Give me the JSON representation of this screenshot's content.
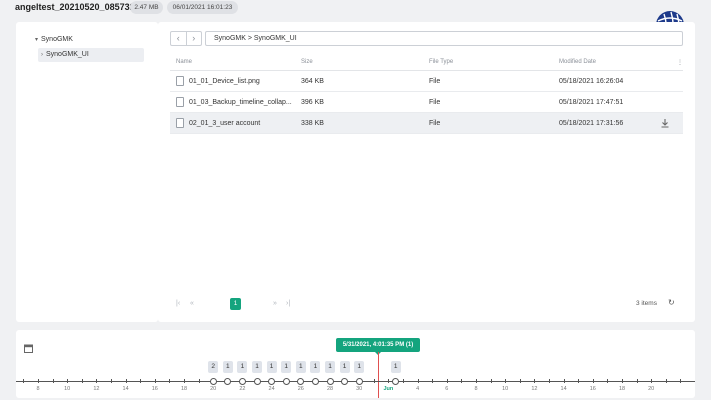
{
  "header": {
    "title": "angeltest_20210520_085732",
    "size": "2.47 MB",
    "datetime": "06/01/2021 16:01:23",
    "logo_icon": "synology-globe-icon"
  },
  "tree": {
    "root": "SynoGMK",
    "child": "SynoGMK_UI"
  },
  "path": {
    "back_icon": "chevron-left-icon",
    "forward_icon": "chevron-right-icon",
    "breadcrumb": "SynoGMK  >  SynoGMK_UI"
  },
  "table": {
    "columns": [
      "Name",
      "Size",
      "File Type",
      "Modified Date"
    ],
    "rows": [
      {
        "name": "01_01_Device_list.png",
        "size": "364 KB",
        "type": "File",
        "date": "05/18/2021 16:26:04"
      },
      {
        "name": "01_03_Backup_timeline_collap...",
        "size": "396 KB",
        "type": "File",
        "date": "05/18/2021 17:47:51"
      },
      {
        "name": "02_01_3_user account",
        "size": "338 KB",
        "type": "File",
        "date": "05/18/2021 17:31:56"
      }
    ]
  },
  "pager": {
    "first": "|‹",
    "prev": "«",
    "page": "1",
    "next": "»",
    "last": "›|",
    "items": "3 items",
    "refresh": "↻"
  },
  "timeline": {
    "tooltip": "5/31/2021, 4:01:35 PM (1)",
    "counts": [
      "2",
      "1",
      "1",
      "1",
      "1",
      "1",
      "1",
      "1",
      "1",
      "1",
      "1",
      "1"
    ],
    "labels": [
      "8",
      "10",
      "12",
      "14",
      "16",
      "18",
      "20",
      "22",
      "24",
      "26",
      "28",
      "30",
      "Jun",
      "4",
      "6",
      "8",
      "10",
      "12",
      "14",
      "16",
      "18",
      "20"
    ],
    "month_label": "Jun",
    "accent": "#14a47e",
    "cursor_color": "#e05050"
  },
  "colors": {
    "accent": "#14a47e",
    "logo": "#1d3a8a"
  }
}
